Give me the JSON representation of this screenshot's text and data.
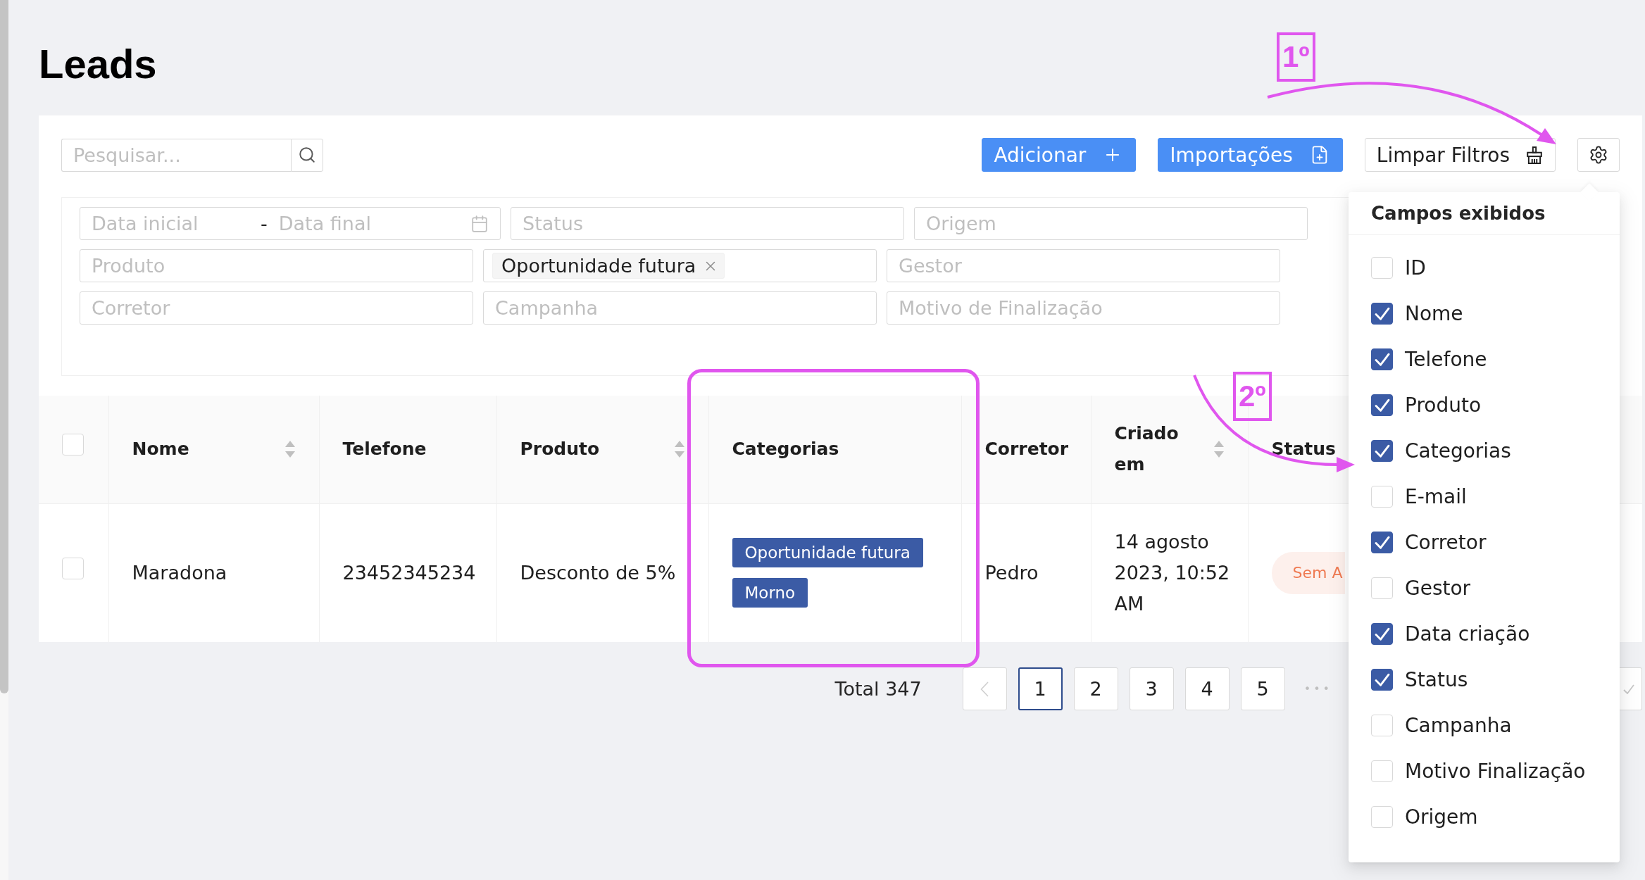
{
  "page": {
    "title": "Leads"
  },
  "toolbar": {
    "search": {
      "placeholder": "Pesquisar..."
    },
    "add_button": {
      "label": "Adicionar"
    },
    "import_button": {
      "label": "Importações"
    },
    "clear_filters_button": {
      "label": "Limpar Filtros"
    }
  },
  "filters": [
    {
      "kind": "date_range",
      "start_placeholder": "Data inicial",
      "separator": "-",
      "end_placeholder": "Data final"
    },
    {
      "kind": "select",
      "placeholder": "Status"
    },
    {
      "kind": "select",
      "placeholder": "Origem"
    },
    {
      "kind": "select",
      "placeholder": "Produto"
    },
    {
      "kind": "tags",
      "values": [
        "Oportunidade futura"
      ]
    },
    {
      "kind": "select",
      "placeholder": "Gestor"
    },
    {
      "kind": "select",
      "placeholder": "Corretor"
    },
    {
      "kind": "select",
      "placeholder": "Campanha"
    },
    {
      "kind": "select",
      "placeholder": "Motivo de Finalização"
    }
  ],
  "table": {
    "columns": [
      {
        "kind": "checkbox",
        "checked": false
      },
      {
        "kind": "text",
        "label": "Nome",
        "sortable": true
      },
      {
        "kind": "text",
        "label": "Telefone",
        "sortable": false
      },
      {
        "kind": "text",
        "label": "Produto",
        "sortable": true
      },
      {
        "kind": "text",
        "label": "Categorias",
        "sortable": false
      },
      {
        "kind": "text",
        "label": "Corretor",
        "sortable": false
      },
      {
        "kind": "text",
        "label": "Criado em",
        "sortable": true
      },
      {
        "kind": "text",
        "label": "Status",
        "sortable": false
      }
    ],
    "rows": [
      {
        "cells": [
          {
            "kind": "checkbox",
            "checked": false
          },
          {
            "kind": "text",
            "text": "Maradona"
          },
          {
            "kind": "text",
            "text": "23452345234"
          },
          {
            "kind": "text",
            "text": "Desconto de 5%"
          },
          {
            "kind": "tags",
            "tags": [
              "Oportunidade futura",
              "Morno"
            ]
          },
          {
            "kind": "text",
            "text": "Pedro"
          },
          {
            "kind": "text",
            "text": "14 agosto 2023, 10:52 AM"
          },
          {
            "kind": "status",
            "text": "Sem A"
          }
        ]
      }
    ]
  },
  "pagination": {
    "total": "Total 347",
    "prev": {
      "disabled": true
    },
    "pages": [
      {
        "label": "1",
        "selected": true
      },
      {
        "label": "2",
        "selected": false
      },
      {
        "label": "3",
        "selected": false
      },
      {
        "label": "4",
        "selected": false
      },
      {
        "label": "5",
        "selected": false
      }
    ],
    "ellipsis": "•••"
  },
  "column_menu": {
    "title": "Campos exibidos",
    "options": [
      {
        "label": "ID",
        "checked": false
      },
      {
        "label": "Nome",
        "checked": true
      },
      {
        "label": "Telefone",
        "checked": true
      },
      {
        "label": "Produto",
        "checked": true
      },
      {
        "label": "Categorias",
        "checked": true
      },
      {
        "label": "E-mail",
        "checked": false
      },
      {
        "label": "Corretor",
        "checked": true
      },
      {
        "label": "Gestor",
        "checked": false
      },
      {
        "label": "Data criação",
        "checked": true
      },
      {
        "label": "Status",
        "checked": true
      },
      {
        "label": "Campanha",
        "checked": false
      },
      {
        "label": "Motivo Finalização",
        "checked": false
      },
      {
        "label": "Origem",
        "checked": false
      }
    ]
  },
  "annotations": [
    {
      "label": "1º"
    },
    {
      "label": "2º"
    }
  ]
}
